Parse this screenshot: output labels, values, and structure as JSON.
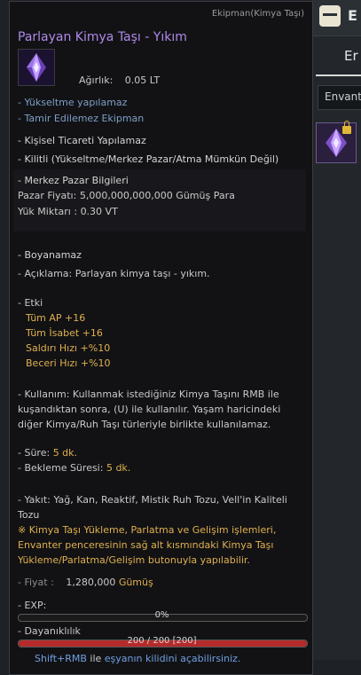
{
  "inventory": {
    "title": "E",
    "tab": "Er",
    "select_label": "Envant"
  },
  "item": {
    "category": "Ekipman(Kimya Taşı)",
    "name": "Parlayan Kimya Taşı - Yıkım",
    "weight_label": "Ağırlık:",
    "weight_value": "0.05 LT",
    "flags": [
      "- Yükseltme yapılamaz",
      "- Tamir Edilemez Ekipman"
    ],
    "rules": [
      "- Kişisel Ticareti Yapılamaz",
      "- Kilitli (Yükseltme/Merkez Pazar/Atma Mümkün Değil)"
    ],
    "market": {
      "header": "- Merkez Pazar Bilgileri",
      "price_label": "Pazar Fiyatı:",
      "price_value": "5,000,000,000,000 Gümüş Para",
      "load_label": "Yük Miktarı :",
      "load_value": "0.30 VT"
    },
    "dye": "- Boyanamaz",
    "description": "- Açıklama: Parlayan kimya taşı - yıkım.",
    "effect_header": "- Etki",
    "effects": [
      "Tüm AP +16",
      "Tüm İsabet +16",
      "Saldırı Hızı +%10",
      "Beceri Hızı +%10"
    ],
    "usage": "- Kullanım: Kullanmak istediğiniz Kimya Taşını RMB ile kuşandıktan sonra, (U) ile kullanılır. Yaşam haricindeki diğer Kimya/Ruh Taşı türleriyle birlikte kullanılamaz.",
    "duration_label": "- Süre:",
    "duration_value": "5 dk.",
    "cooldown_label": "- Bekleme Süresi:",
    "cooldown_value": "5 dk.",
    "fuel": "- Yakıt: Yağ, Kan, Reaktif, Mistik Ruh Tozu, Vell'in Kaliteli Tozu",
    "note": "※ Kimya Taşı Yükleme, Parlatma ve Gelişim işlemleri, Envanter penceresinin sağ alt kısmındaki Kimya Taşı Yükleme/Parlatma/Gelişim butonuyla yapılabilir.",
    "price_label": "- Fiyat :",
    "price_value": "1,280,000",
    "price_currency": "Gümüş",
    "exp_label": "- EXP:",
    "exp_text": "0%",
    "exp_fraction": 0,
    "durability_label": "- Dayanıklılık",
    "durability_text": "200 / 200   [200]",
    "durability_fraction": 1,
    "hint_key": "Shift+RMB",
    "hint_mid": " ile ",
    "hint_link": "eşyanın kilidini açabilirsiniz."
  },
  "colors": {
    "title": "#b089e8",
    "highlight": "#dfb04d",
    "durability": "#b52a2a"
  }
}
